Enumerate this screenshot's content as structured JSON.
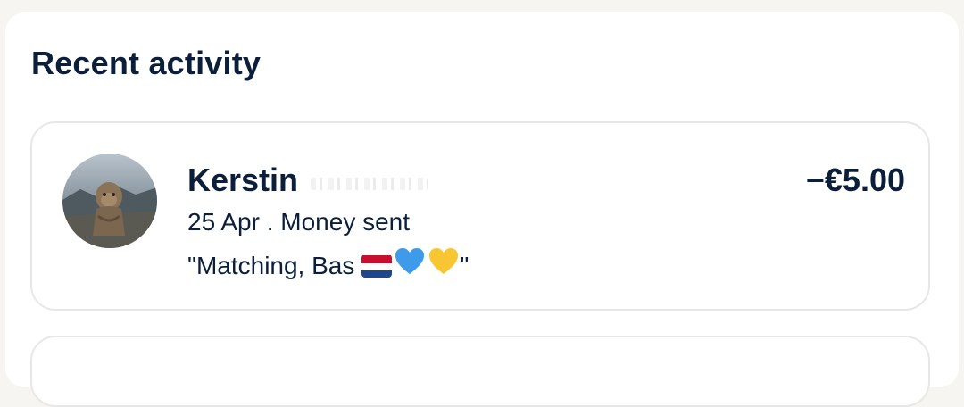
{
  "section": {
    "title": "Recent activity"
  },
  "activity": [
    {
      "name": "Kerstin",
      "amount": "−€5.00",
      "meta": "25 Apr . Money sent",
      "note_prefix": "\"Matching, Bas ",
      "note_suffix": "\"",
      "note_emojis": [
        "netherlands-flag",
        "blue-heart",
        "yellow-heart"
      ]
    }
  ],
  "colors": {
    "text": "#0b1f3a",
    "card_border": "#e7e7e6",
    "page_bg": "#f6f5f2"
  }
}
